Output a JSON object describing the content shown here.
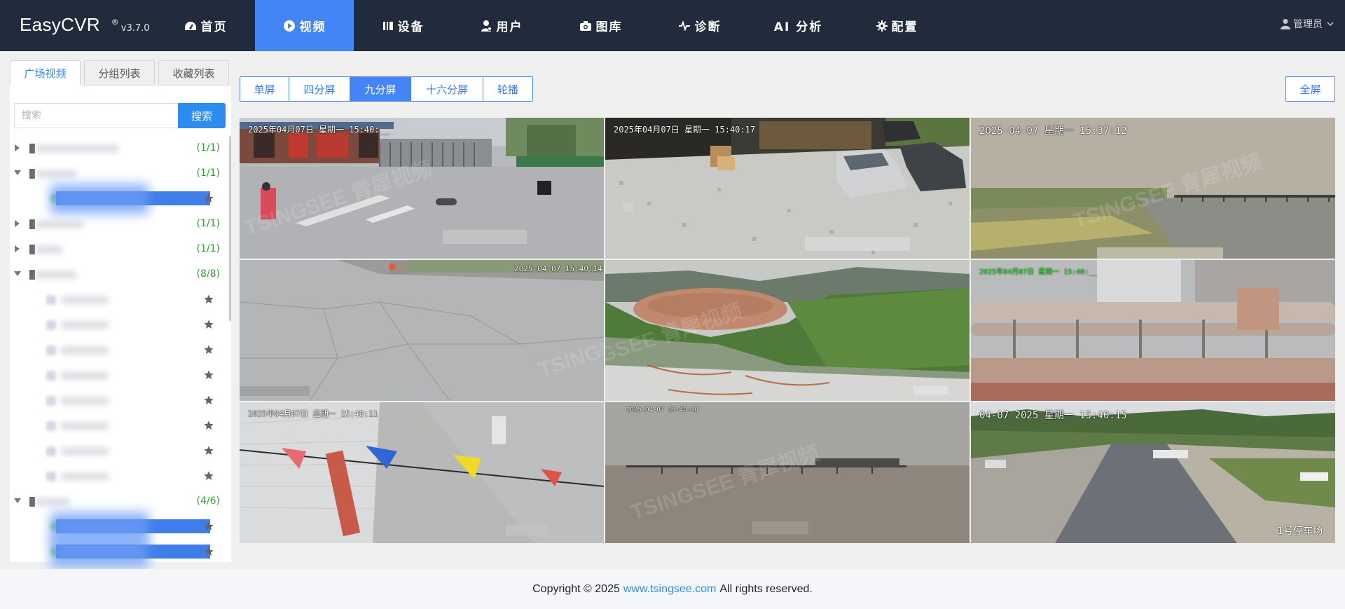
{
  "header": {
    "brand": "EasyCVR",
    "reg": "®",
    "version": "v3.7.0",
    "nav": [
      {
        "label": "首页",
        "icon": "dashboard-icon"
      },
      {
        "label": "视频",
        "icon": "play-circle-icon",
        "active": true
      },
      {
        "label": "设备",
        "icon": "device-icon"
      },
      {
        "label": "用户",
        "icon": "users-icon"
      },
      {
        "label": "图库",
        "icon": "camera-gallery-icon"
      },
      {
        "label": "诊断",
        "icon": "pulse-icon"
      },
      {
        "label": "AI 分析",
        "icon": ""
      },
      {
        "label": "配置",
        "icon": "gear-icon"
      }
    ],
    "user": "管理员",
    "active_color": "#4385f5",
    "bg_color": "#222b3c"
  },
  "sidebar": {
    "tabs": [
      "广场视频",
      "分组列表",
      "收藏列表"
    ],
    "active_tab": 0,
    "search": {
      "placeholder": "搜索",
      "button": "搜索"
    },
    "tree": [
      {
        "type": "group",
        "expanded": false,
        "count": "(1/1)"
      },
      {
        "type": "group",
        "expanded": true,
        "count": "(1/1)"
      },
      {
        "type": "channel",
        "selected": true
      },
      {
        "type": "group",
        "expanded": false,
        "count": "(1/1)"
      },
      {
        "type": "group",
        "expanded": false,
        "count": "(1/1)"
      },
      {
        "type": "group",
        "expanded": true,
        "count": "(8/8)"
      },
      {
        "type": "channel"
      },
      {
        "type": "channel"
      },
      {
        "type": "channel"
      },
      {
        "type": "channel"
      },
      {
        "type": "channel"
      },
      {
        "type": "channel"
      },
      {
        "type": "channel"
      },
      {
        "type": "channel"
      },
      {
        "type": "group",
        "expanded": true,
        "count": "(4/6)"
      },
      {
        "type": "channel",
        "selected": true
      },
      {
        "type": "channel",
        "selected": true
      }
    ]
  },
  "main": {
    "layouts": [
      "单屏",
      "四分屏",
      "九分屏",
      "十六分屏",
      "轮播"
    ],
    "active_layout": 2,
    "fullscreen": "全屏",
    "tiles": [
      {
        "time": "2025年04月07日 星期一 15:40:__",
        "cap": ""
      },
      {
        "time": "2025年04月07日 星期一 15:40:17",
        "cap": ""
      },
      {
        "time": "2025-04-07 星期一 15:37:12",
        "cap": ""
      },
      {
        "time": "2025-04-07 15:40:14",
        "cap": ""
      },
      {
        "time": "",
        "cap": ""
      },
      {
        "time": "2025年04月07日 星期一 15:40:__",
        "cap": ""
      },
      {
        "time": "2025年04月07日 星期一 15:40:11",
        "cap": ""
      },
      {
        "time": "2025-04-07 15:40:10",
        "cap": ""
      },
      {
        "time": "04-07 2025 星期一 15:40:15",
        "cap": "1号停车场"
      }
    ],
    "watermark": "TSINGSEE 青犀视频"
  },
  "footer": {
    "prefix": "Copyright © 2025",
    "link": "www.tsingsee.com",
    "suffix": "All rights reserved."
  }
}
